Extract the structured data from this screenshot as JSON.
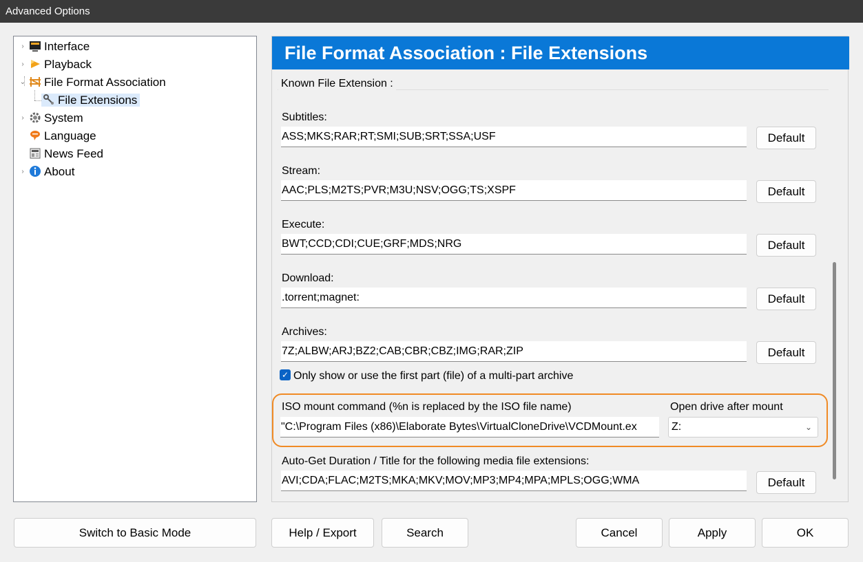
{
  "window": {
    "title": "Advanced Options"
  },
  "tree": {
    "items": [
      {
        "label": "Interface",
        "icon": "monitor-icon"
      },
      {
        "label": "Playback",
        "icon": "play-icon"
      },
      {
        "label": "File Format Association",
        "icon": "file-association-icon"
      },
      {
        "label": "File Extensions",
        "icon": "wrench-icon"
      },
      {
        "label": "System",
        "icon": "gear-icon"
      },
      {
        "label": "Language",
        "icon": "speech-bubble-icon"
      },
      {
        "label": "News Feed",
        "icon": "newspaper-icon"
      },
      {
        "label": "About",
        "icon": "info-icon"
      }
    ]
  },
  "panel": {
    "header": "File Format Association : File Extensions",
    "group_label": "Known File Extension :",
    "fields": [
      {
        "label": "Subtitles:",
        "value": "ASS;MKS;RAR;RT;SMI;SUB;SRT;SSA;USF",
        "button": "Default"
      },
      {
        "label": "Stream:",
        "value": "AAC;PLS;M2TS;PVR;M3U;NSV;OGG;TS;XSPF",
        "button": "Default"
      },
      {
        "label": "Execute:",
        "value": "BWT;CCD;CDI;CUE;GRF;MDS;NRG",
        "button": "Default"
      },
      {
        "label": "Download:",
        "value": ".torrent;magnet:",
        "button": "Default"
      },
      {
        "label": "Archives:",
        "value": "7Z;ALBW;ARJ;BZ2;CAB;CBR;CBZ;IMG;RAR;ZIP",
        "button": "Default"
      }
    ],
    "archive_checkbox": {
      "label": "Only show or use the first part (file) of a multi-part archive",
      "checked": true
    },
    "iso": {
      "label": "ISO mount command (%n is replaced by the ISO file name)",
      "value": "\"C:\\Program Files (x86)\\Elaborate Bytes\\VirtualCloneDrive\\VCDMount.ex",
      "drive_label": "Open drive after mount",
      "drive_value": "Z:"
    },
    "autoget": {
      "label": "Auto-Get Duration / Title for the following media file extensions:",
      "value": "AVI;CDA;FLAC;M2TS;MKA;MKV;MOV;MP3;MP4;MPA;MPLS;OGG;WMA",
      "button": "Default"
    }
  },
  "buttons": {
    "switch_mode": "Switch to Basic Mode",
    "help_export": "Help / Export",
    "search": "Search",
    "cancel": "Cancel",
    "apply": "Apply",
    "ok": "OK"
  },
  "colors": {
    "accent": "#0a78d7",
    "highlight": "#f08a24",
    "titlebar": "#3a3a3a"
  }
}
